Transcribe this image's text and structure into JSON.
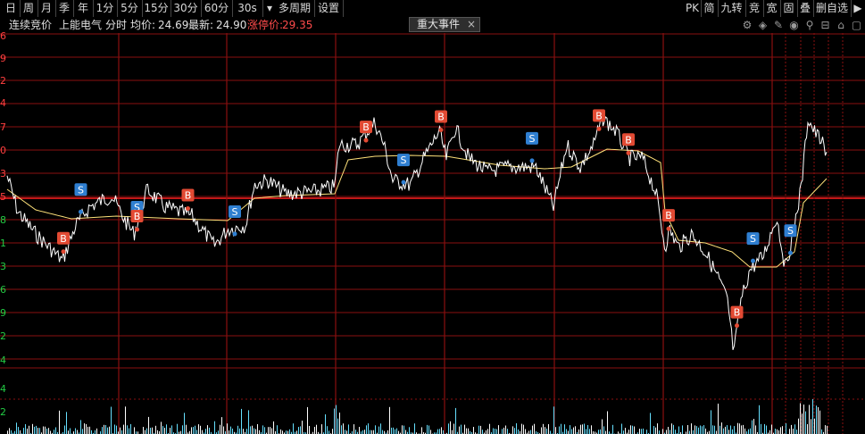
{
  "toolbar": {
    "left_items": [
      "日",
      "周",
      "月",
      "季",
      "年",
      "1分",
      "5分",
      "15分",
      "30分",
      "60分",
      "30s",
      "多周期",
      "设置"
    ],
    "dropdown_icon": "triangle-down-icon",
    "right_items": [
      "PK",
      "简",
      "九转",
      "竞",
      "宽",
      "固",
      "叠",
      "删自选"
    ],
    "arrow_icon": "arrow-right-icon"
  },
  "infobar": {
    "mode": "连续竞价",
    "stock_name": "上能电气",
    "view": "分时",
    "avg_label": "均价:",
    "avg_value": "24.69",
    "latest_label": "最新:",
    "latest_value": "24.90",
    "limit_label": "涨停价:",
    "limit_value": "29.35"
  },
  "event_tag": {
    "label": "重大事件",
    "close": "×"
  },
  "tools": [
    "gear-icon",
    "eraser-icon",
    "pen-icon",
    "eye-icon",
    "pin-icon",
    "bag-icon",
    "trash-icon",
    "lock-icon",
    "window-icon"
  ],
  "colors": {
    "background": "#000000",
    "grid": "#8a0f0f",
    "price": "#ffffff",
    "avg": "#ffe27a",
    "buy": "#e24a33",
    "sell": "#2f7fd1",
    "vol_up": "#ffffff",
    "vol_down": "#66e0ff"
  },
  "chart_data": {
    "type": "line",
    "y_tick_labels": [
      "6",
      "9",
      "2",
      "4",
      "7",
      "0",
      "3",
      "5",
      "8",
      "1",
      "3",
      "6",
      "9",
      "2",
      "4"
    ],
    "volume_tick_labels": [
      "4",
      "2"
    ],
    "x_ticks": 8,
    "series": [],
    "markers": [
      {
        "label": "B",
        "index": 42
      },
      {
        "label": "S",
        "index": 55
      },
      {
        "label": "S",
        "index": 97
      },
      {
        "label": "B",
        "index": 97
      },
      {
        "label": "B",
        "index": 135
      },
      {
        "label": "S",
        "index": 170
      },
      {
        "label": "B",
        "index": 268
      },
      {
        "label": "S",
        "index": 296
      },
      {
        "label": "B",
        "index": 324
      },
      {
        "label": "S",
        "index": 392
      },
      {
        "label": "B",
        "index": 442
      },
      {
        "label": "B",
        "index": 464
      },
      {
        "label": "B",
        "index": 494
      },
      {
        "label": "B",
        "index": 545
      },
      {
        "label": "S",
        "index": 557
      },
      {
        "label": "S",
        "index": 585
      }
    ]
  }
}
